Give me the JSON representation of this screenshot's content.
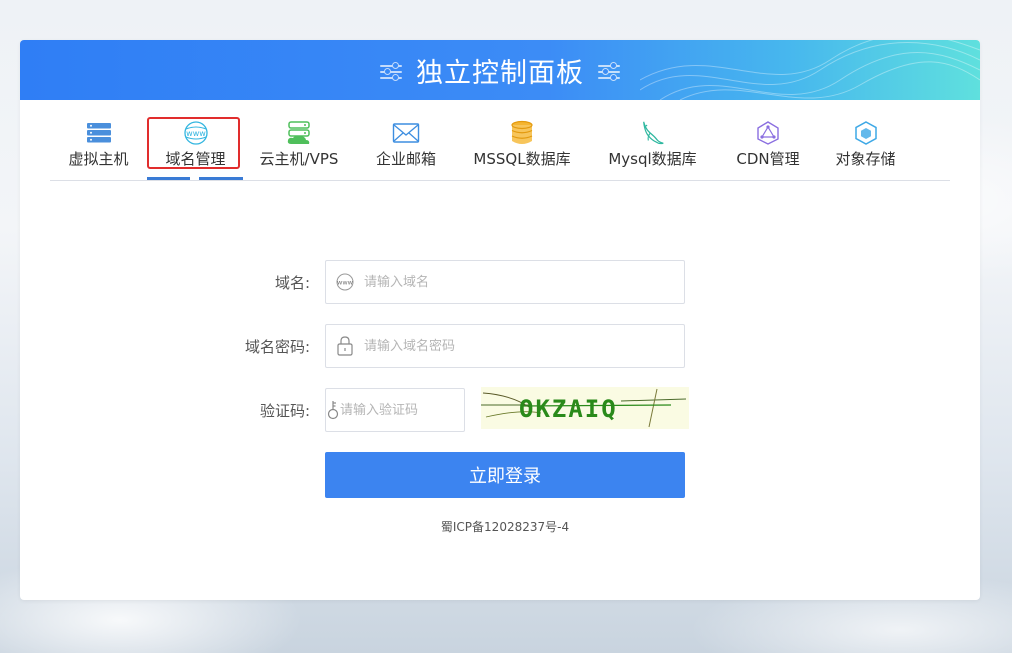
{
  "header": {
    "title": "独立控制面板"
  },
  "tabs": [
    {
      "label": "虚拟主机",
      "icon": "server-icon",
      "active": false
    },
    {
      "label": "域名管理",
      "icon": "www-globe-icon",
      "active": true
    },
    {
      "label": "云主机/VPS",
      "icon": "cloud-server-icon",
      "active": false
    },
    {
      "label": "企业邮箱",
      "icon": "mail-icon",
      "active": false
    },
    {
      "label": "MSSQL数据库",
      "icon": "database-icon",
      "active": false
    },
    {
      "label": "Mysql数据库",
      "icon": "dolphin-icon",
      "active": false
    },
    {
      "label": "CDN管理",
      "icon": "cdn-icon",
      "active": false
    },
    {
      "label": "对象存储",
      "icon": "cube-icon",
      "active": false
    }
  ],
  "form": {
    "domain": {
      "label": "域名:",
      "placeholder": "请输入域名",
      "value": ""
    },
    "password": {
      "label": "域名密码:",
      "placeholder": "请输入域名密码",
      "value": ""
    },
    "captcha": {
      "label": "验证码:",
      "placeholder": "请输入验证码",
      "value": "",
      "image_text": "OKZAIQ"
    },
    "submit_label": "立即登录"
  },
  "footer": {
    "icp": "蜀ICP备12028237号-4"
  },
  "colors": {
    "accent": "#3c84f0",
    "header_start": "#2f7ef5",
    "header_end": "#5fe0de",
    "highlight": "#e12d2d"
  }
}
